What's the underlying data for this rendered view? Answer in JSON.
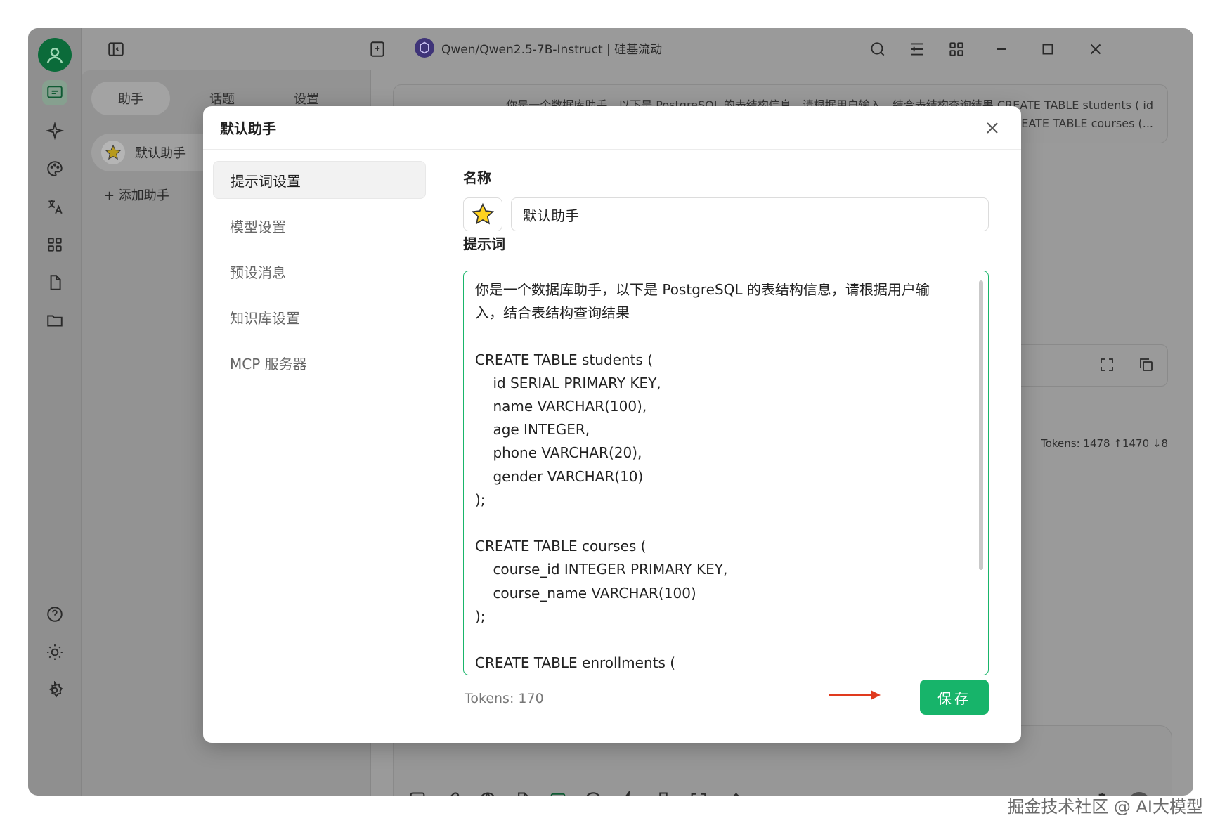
{
  "window": {
    "model_title": "Qwen/Qwen2.5-7B-Instruct | 硅基流动"
  },
  "left_panel": {
    "tabs": [
      {
        "label": "助手"
      },
      {
        "label": "话题"
      },
      {
        "label": "设置"
      }
    ],
    "assistant_name": "默认助手",
    "add_assistant": "+ 添加助手"
  },
  "chat": {
    "bubble_line1": "你是一个数据库助手，以下是 PostgreSQL 的表结构信息，请根据用户输入，结合表结构查询结果 CREATE TABLE students ( id",
    "bubble_line2": "CREATE TABLE courses (...",
    "tokens": "Tokens: 1478 ↑1470 ↓8"
  },
  "modal": {
    "title": "默认助手",
    "nav": [
      {
        "label": "提示词设置",
        "active": true
      },
      {
        "label": "模型设置",
        "active": false
      },
      {
        "label": "预设消息",
        "active": false
      },
      {
        "label": "知识库设置",
        "active": false
      },
      {
        "label": "MCP 服务器",
        "active": false
      }
    ],
    "name_label": "名称",
    "name_value": "默认助手",
    "prompt_label": "提示词",
    "prompt_text": "你是一个数据库助手，以下是 PostgreSQL 的表结构信息，请根据用户输\n入，结合表结构查询结果\n\nCREATE TABLE students (\n    id SERIAL PRIMARY KEY,\n    name VARCHAR(100),\n    age INTEGER,\n    phone VARCHAR(20),\n    gender VARCHAR(10)\n);\n\nCREATE TABLE courses (\n    course_id INTEGER PRIMARY KEY,\n    course_name VARCHAR(100)\n);\n\nCREATE TABLE enrollments (",
    "tokens": "Tokens: 170",
    "save_label": "保存"
  },
  "watermark": "掘金技术社区 @ AI大模型",
  "colors": {
    "accent": "#17b46a",
    "arrow": "#e03a1e"
  }
}
